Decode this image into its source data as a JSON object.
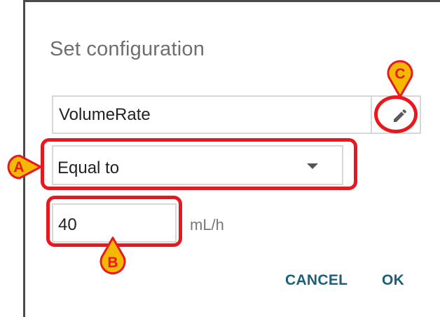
{
  "dialog": {
    "title": "Set configuration",
    "parameter_value": "VolumeRate",
    "operator_value": "Equal to",
    "threshold_value": "40",
    "unit": "mL/h",
    "cancel_label": "CANCEL",
    "ok_label": "OK"
  },
  "annotations": {
    "a": "A",
    "b": "B",
    "c": "C",
    "marker_color": "#e8181e",
    "marker_fill": "#f5b800"
  },
  "icons": {
    "edit": "pencil-icon",
    "dropdown": "dropdown-arrow-icon"
  },
  "colors": {
    "action_text": "#1b5e7d",
    "title_text": "#6f6f6f"
  }
}
